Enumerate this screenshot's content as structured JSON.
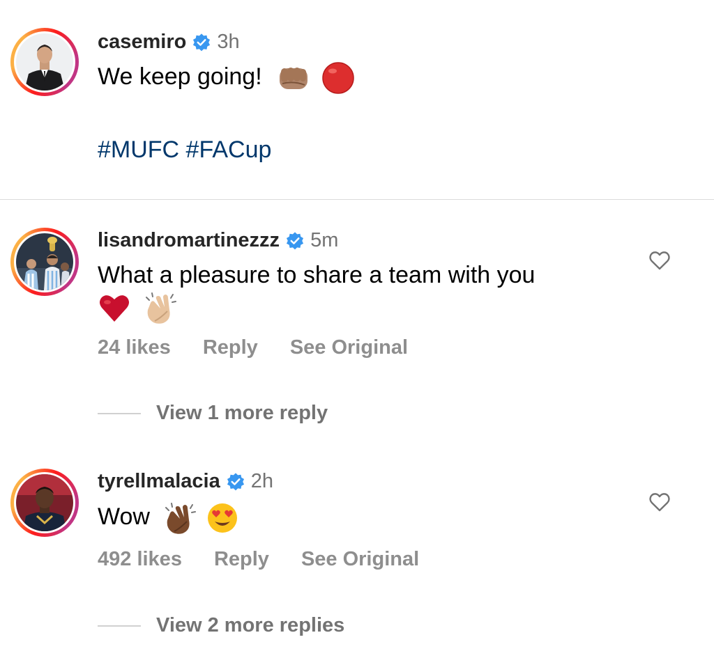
{
  "caption": {
    "username": "casemiro",
    "time": "3h",
    "text": "We keep going!",
    "hashtags": "#MUFC #FACup"
  },
  "comments": [
    {
      "username": "lisandromartinezzz",
      "time": "5m",
      "text": "What a pleasure to share a team with you",
      "likes": "24 likes",
      "reply_label": "Reply",
      "see_original_label": "See Original",
      "view_replies_label": "View 1 more reply"
    },
    {
      "username": "tyrellmalacia",
      "time": "2h",
      "text": "Wow",
      "likes": "492 likes",
      "reply_label": "Reply",
      "see_original_label": "See Original",
      "view_replies_label": "View 2 more replies"
    }
  ],
  "icons": {
    "verified": "verified-badge-icon",
    "heart": "heart-outline-icon"
  },
  "colors": {
    "verified_blue": "#3897f0",
    "hashtag_blue": "#00376b",
    "muted_gray": "#8e8e8e"
  }
}
